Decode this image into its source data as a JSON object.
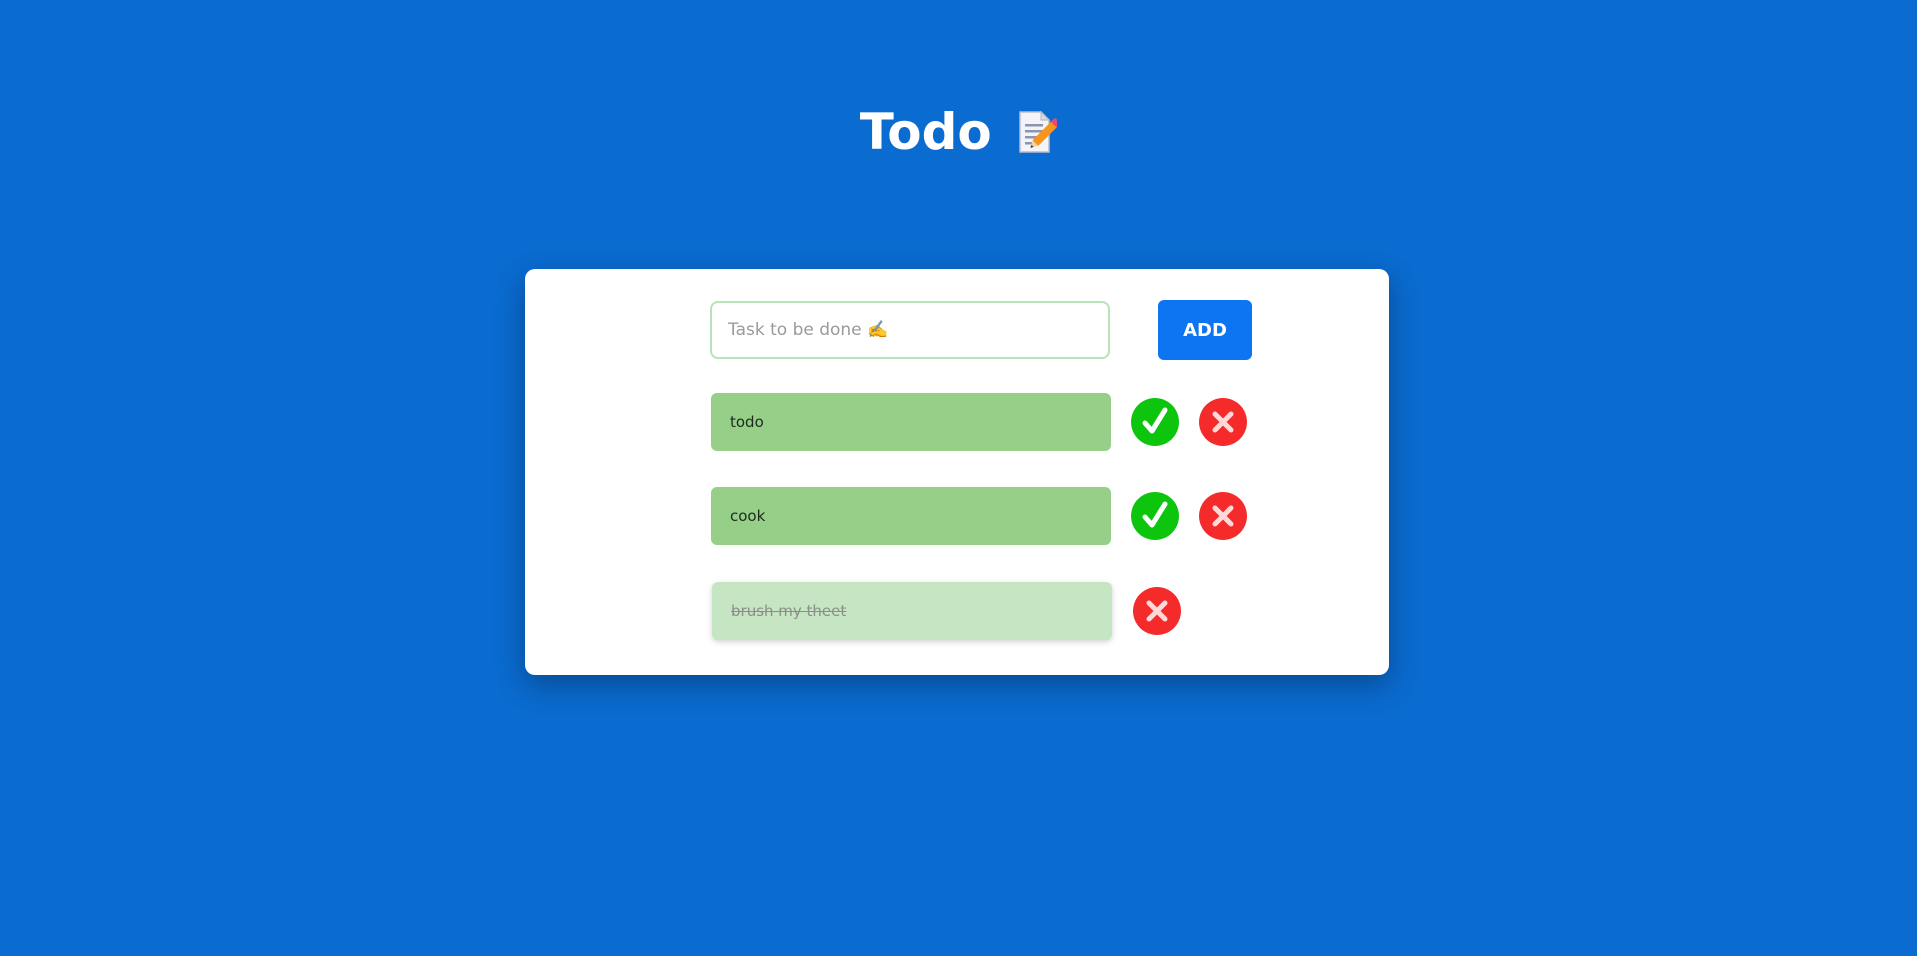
{
  "app": {
    "title": "Todo"
  },
  "new_task": {
    "placeholder": "Task to be done ✍️",
    "value": "",
    "add_label": "ADD"
  },
  "todos": [
    {
      "text": "todo",
      "completed": false
    },
    {
      "text": "cook",
      "completed": false
    },
    {
      "text": "brush my theet",
      "completed": true
    }
  ],
  "icons": {
    "title": "memo-icon",
    "complete": "check-icon",
    "delete": "close-icon"
  },
  "colors": {
    "background": "#0a6bd0",
    "card": "#ffffff",
    "add_button": "#0d75f2",
    "todo_item": "#95cf88",
    "todo_item_done": "#c6e5c2",
    "complete_button": "#0ec50e",
    "delete_button": "#f52b2b",
    "input_border": "#b8e3b8"
  }
}
